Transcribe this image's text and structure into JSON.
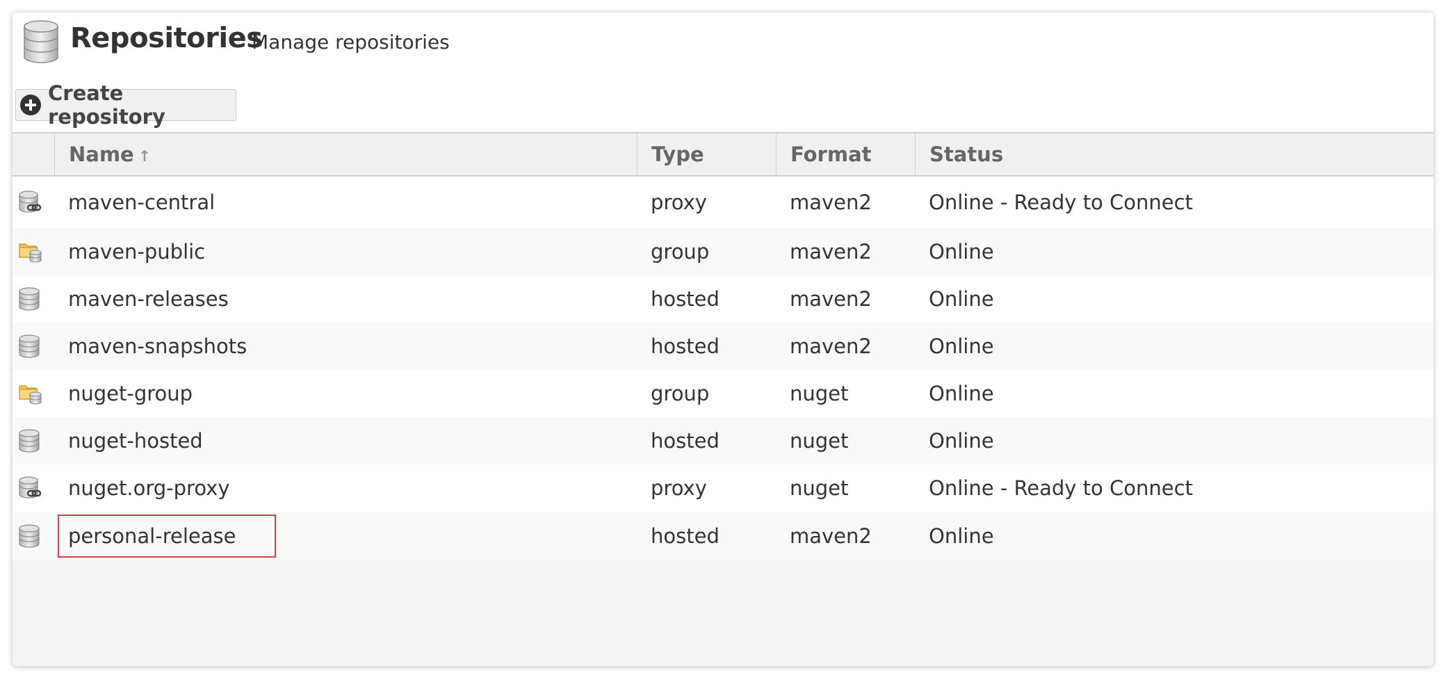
{
  "header": {
    "title": "Repositories",
    "subtitle": "Manage repositories",
    "icon": "database-icon"
  },
  "toolbar": {
    "create_label": "Create repository"
  },
  "grid": {
    "columns": [
      "Name",
      "Type",
      "Format",
      "Status"
    ],
    "sort_indicator": "↑",
    "rows": [
      {
        "icon": "proxy",
        "name": "maven-central",
        "type": "proxy",
        "format": "maven2",
        "status": "Online - Ready to Connect"
      },
      {
        "icon": "group",
        "name": "maven-public",
        "type": "group",
        "format": "maven2",
        "status": "Online"
      },
      {
        "icon": "hosted",
        "name": "maven-releases",
        "type": "hosted",
        "format": "maven2",
        "status": "Online"
      },
      {
        "icon": "hosted",
        "name": "maven-snapshots",
        "type": "hosted",
        "format": "maven2",
        "status": "Online"
      },
      {
        "icon": "group",
        "name": "nuget-group",
        "type": "group",
        "format": "nuget",
        "status": "Online"
      },
      {
        "icon": "hosted",
        "name": "nuget-hosted",
        "type": "hosted",
        "format": "nuget",
        "status": "Online"
      },
      {
        "icon": "proxy",
        "name": "nuget.org-proxy",
        "type": "proxy",
        "format": "nuget",
        "status": "Online - Ready to Connect"
      },
      {
        "icon": "hosted",
        "name": "personal-release",
        "type": "hosted",
        "format": "maven2",
        "status": "Online"
      }
    ]
  },
  "colors": {
    "highlight": "#e03c3c",
    "folder": "#f2c25a"
  }
}
